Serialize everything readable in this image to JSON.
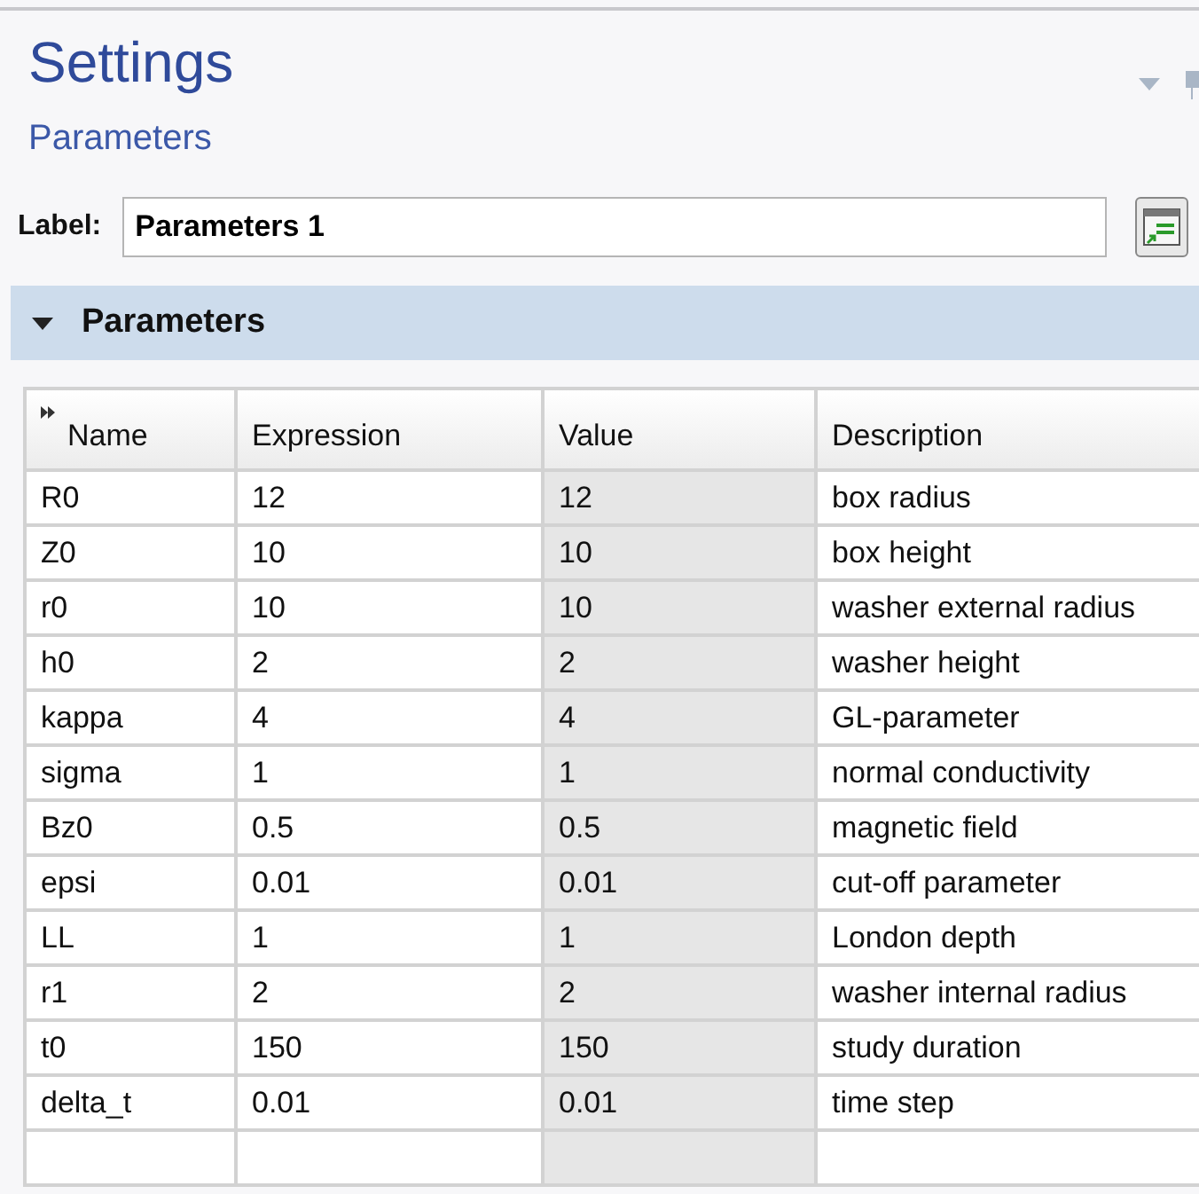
{
  "window": {
    "title": "Settings",
    "subtitle": "Parameters"
  },
  "label_field": {
    "label": "Label:",
    "value": "Parameters 1"
  },
  "section": {
    "title": "Parameters",
    "expanded": true
  },
  "table": {
    "columns": [
      {
        "label": "Name",
        "read_only": false
      },
      {
        "label": "Expression",
        "read_only": false
      },
      {
        "label": "Value",
        "read_only": true
      },
      {
        "label": "Description",
        "read_only": false
      }
    ],
    "rows": [
      [
        "R0",
        "12",
        "12",
        "box radius"
      ],
      [
        "Z0",
        "10",
        "10",
        "box height"
      ],
      [
        "r0",
        "10",
        "10",
        "washer external radius"
      ],
      [
        "h0",
        "2",
        "2",
        "washer height"
      ],
      [
        "kappa",
        "4",
        "4",
        "GL-parameter"
      ],
      [
        "sigma",
        "1",
        "1",
        "normal conductivity"
      ],
      [
        "Bz0",
        "0.5",
        "0.5",
        "magnetic field"
      ],
      [
        "epsi",
        "0.01",
        "0.01",
        "cut-off parameter"
      ],
      [
        "LL",
        "1",
        "1",
        "London depth"
      ],
      [
        "r1",
        "2",
        "2",
        "washer internal radius"
      ],
      [
        "t0",
        "150",
        "150",
        "study duration"
      ],
      [
        "delta_t",
        "0.01",
        "0.01",
        "time step"
      ]
    ]
  }
}
